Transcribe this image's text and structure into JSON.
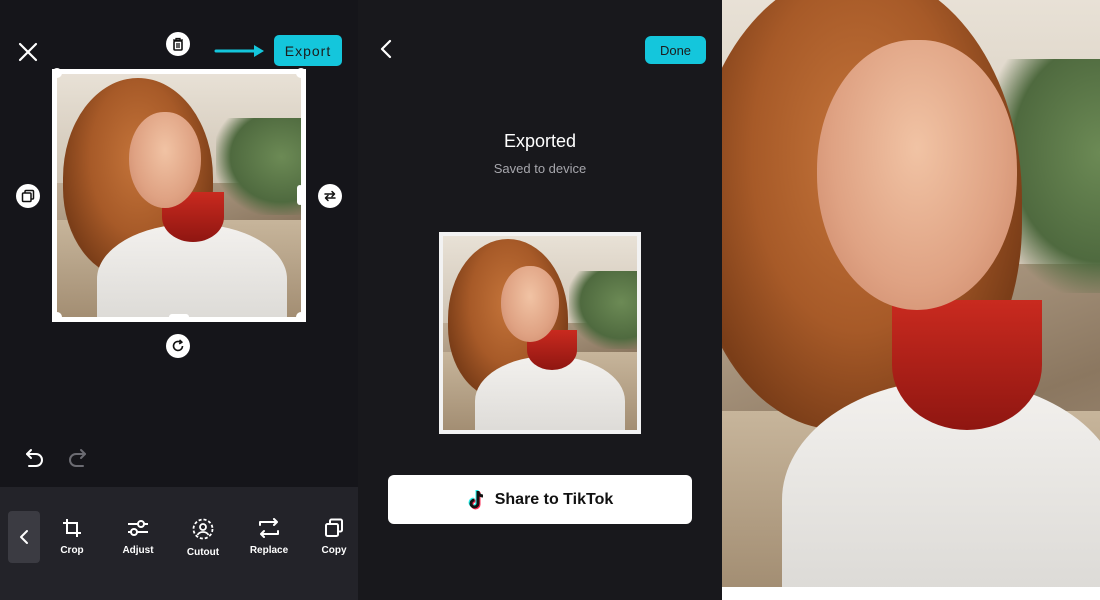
{
  "editor": {
    "close_icon": "close-icon",
    "delete_icon": "trash-icon",
    "export_label": "Export",
    "duplicate_icon": "copy-icon",
    "replace_icon": "swap-icon",
    "rotate_icon": "rotate-icon",
    "undo_icon": "undo-icon",
    "redo_icon": "redo-icon",
    "tools": [
      {
        "label": "Crop",
        "icon": "crop-icon"
      },
      {
        "label": "Adjust",
        "icon": "sliders-icon"
      },
      {
        "label": "Cutout",
        "icon": "cutout-icon"
      },
      {
        "label": "Replace",
        "icon": "replace-icon"
      },
      {
        "label": "Copy",
        "icon": "copy-icon"
      }
    ],
    "colors": {
      "accent": "#14c6dc",
      "background": "#15151a",
      "toolbar": "#232329"
    }
  },
  "export_screen": {
    "back_icon": "chevron-left-icon",
    "done_label": "Done",
    "title": "Exported",
    "subtitle": "Saved to device",
    "share_label": "Share to TikTok",
    "share_icon": "tiktok-icon"
  }
}
